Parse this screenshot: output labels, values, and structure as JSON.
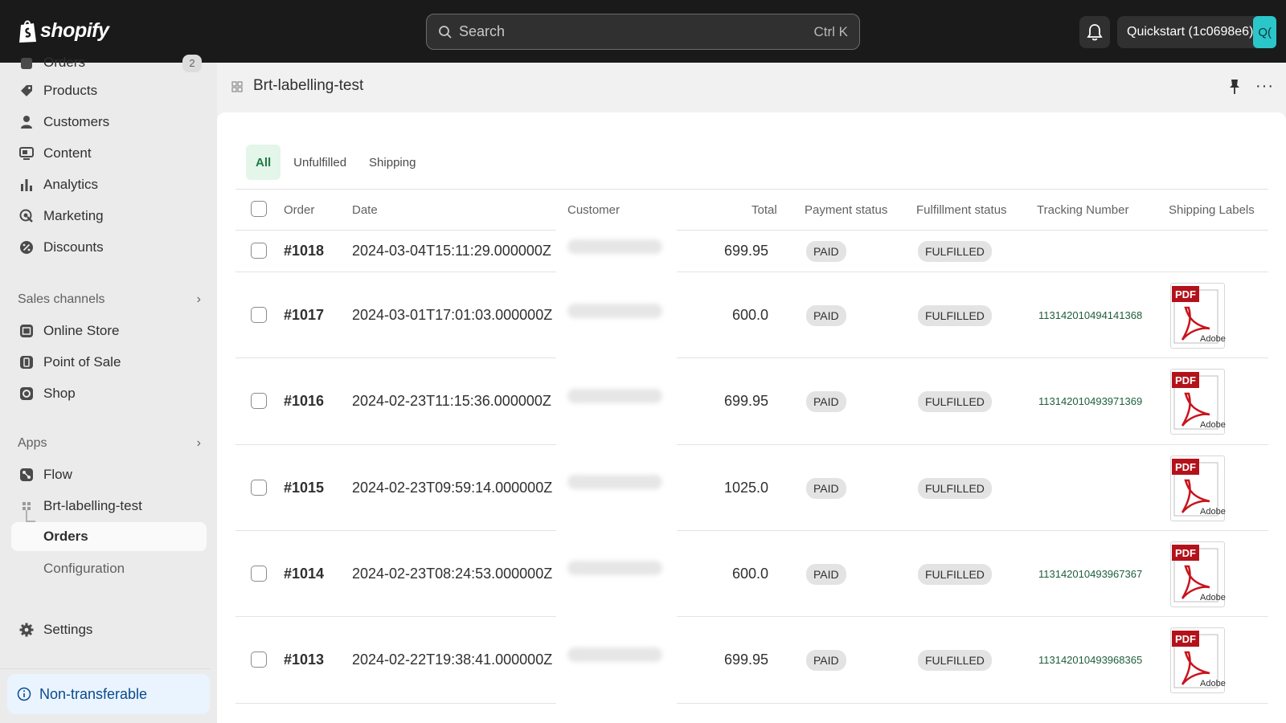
{
  "topbar": {
    "brand": "shopify",
    "search_placeholder": "Search",
    "search_shortcut": "Ctrl K",
    "account_name": "Quickstart (1c0698e6)",
    "account_avatar": "Q(",
    "icons": [
      "shopify-bag-icon",
      "search-icon",
      "bell-icon"
    ]
  },
  "sidebar": {
    "partial_item": {
      "label": "Orders",
      "badge": "2"
    },
    "items": [
      {
        "label": "Products",
        "icon": "tag-icon"
      },
      {
        "label": "Customers",
        "icon": "person-icon"
      },
      {
        "label": "Content",
        "icon": "content-icon"
      },
      {
        "label": "Analytics",
        "icon": "bar-chart-icon"
      },
      {
        "label": "Marketing",
        "icon": "target-icon"
      },
      {
        "label": "Discounts",
        "icon": "discount-icon"
      }
    ],
    "sales_channels_heading": "Sales channels",
    "sales_channels": [
      {
        "label": "Online Store",
        "icon": "store-icon"
      },
      {
        "label": "Point of Sale",
        "icon": "pos-icon"
      },
      {
        "label": "Shop",
        "icon": "shop-icon"
      }
    ],
    "apps_heading": "Apps",
    "apps": [
      {
        "label": "Flow",
        "icon": "flow-icon"
      },
      {
        "label": "Brt-labelling-test",
        "icon": "app-grid-icon"
      },
      {
        "label": "Orders",
        "active": true
      },
      {
        "label": "Configuration"
      }
    ],
    "settings_label": "Settings",
    "non_transferable_label": "Non-transferable"
  },
  "app_header": {
    "title": "Brt-labelling-test"
  },
  "tabs": [
    {
      "label": "All",
      "active": true
    },
    {
      "label": "Unfulfilled",
      "active": false
    },
    {
      "label": "Shipping",
      "active": false
    }
  ],
  "table": {
    "columns": [
      "Order",
      "Date",
      "Customer",
      "Total",
      "Payment status",
      "Fulfillment status",
      "Tracking Number",
      "Shipping Labels"
    ],
    "rows": [
      {
        "order": "#1018",
        "date": "2024-03-04T15:11:29.000000Z",
        "total": "699.95",
        "payment": "PAID",
        "fulfillment": "FULFILLED",
        "tracking": "",
        "has_label": false
      },
      {
        "order": "#1017",
        "date": "2024-03-01T17:01:03.000000Z",
        "total": "600.0",
        "payment": "PAID",
        "fulfillment": "FULFILLED",
        "tracking": "113142010494141368",
        "has_label": true
      },
      {
        "order": "#1016",
        "date": "2024-02-23T11:15:36.000000Z",
        "total": "699.95",
        "payment": "PAID",
        "fulfillment": "FULFILLED",
        "tracking": "113142010493971369",
        "has_label": true
      },
      {
        "order": "#1015",
        "date": "2024-02-23T09:59:14.000000Z",
        "total": "1025.0",
        "payment": "PAID",
        "fulfillment": "FULFILLED",
        "tracking": "",
        "has_label": true
      },
      {
        "order": "#1014",
        "date": "2024-02-23T08:24:53.000000Z",
        "total": "600.0",
        "payment": "PAID",
        "fulfillment": "FULFILLED",
        "tracking": "113142010493967367",
        "has_label": true
      },
      {
        "order": "#1013",
        "date": "2024-02-22T19:38:41.000000Z",
        "total": "699.95",
        "payment": "PAID",
        "fulfillment": "FULFILLED",
        "tracking": "113142010493968365",
        "has_label": true
      }
    ],
    "pdf_badge": "PDF",
    "pdf_brand": "Adobe"
  }
}
